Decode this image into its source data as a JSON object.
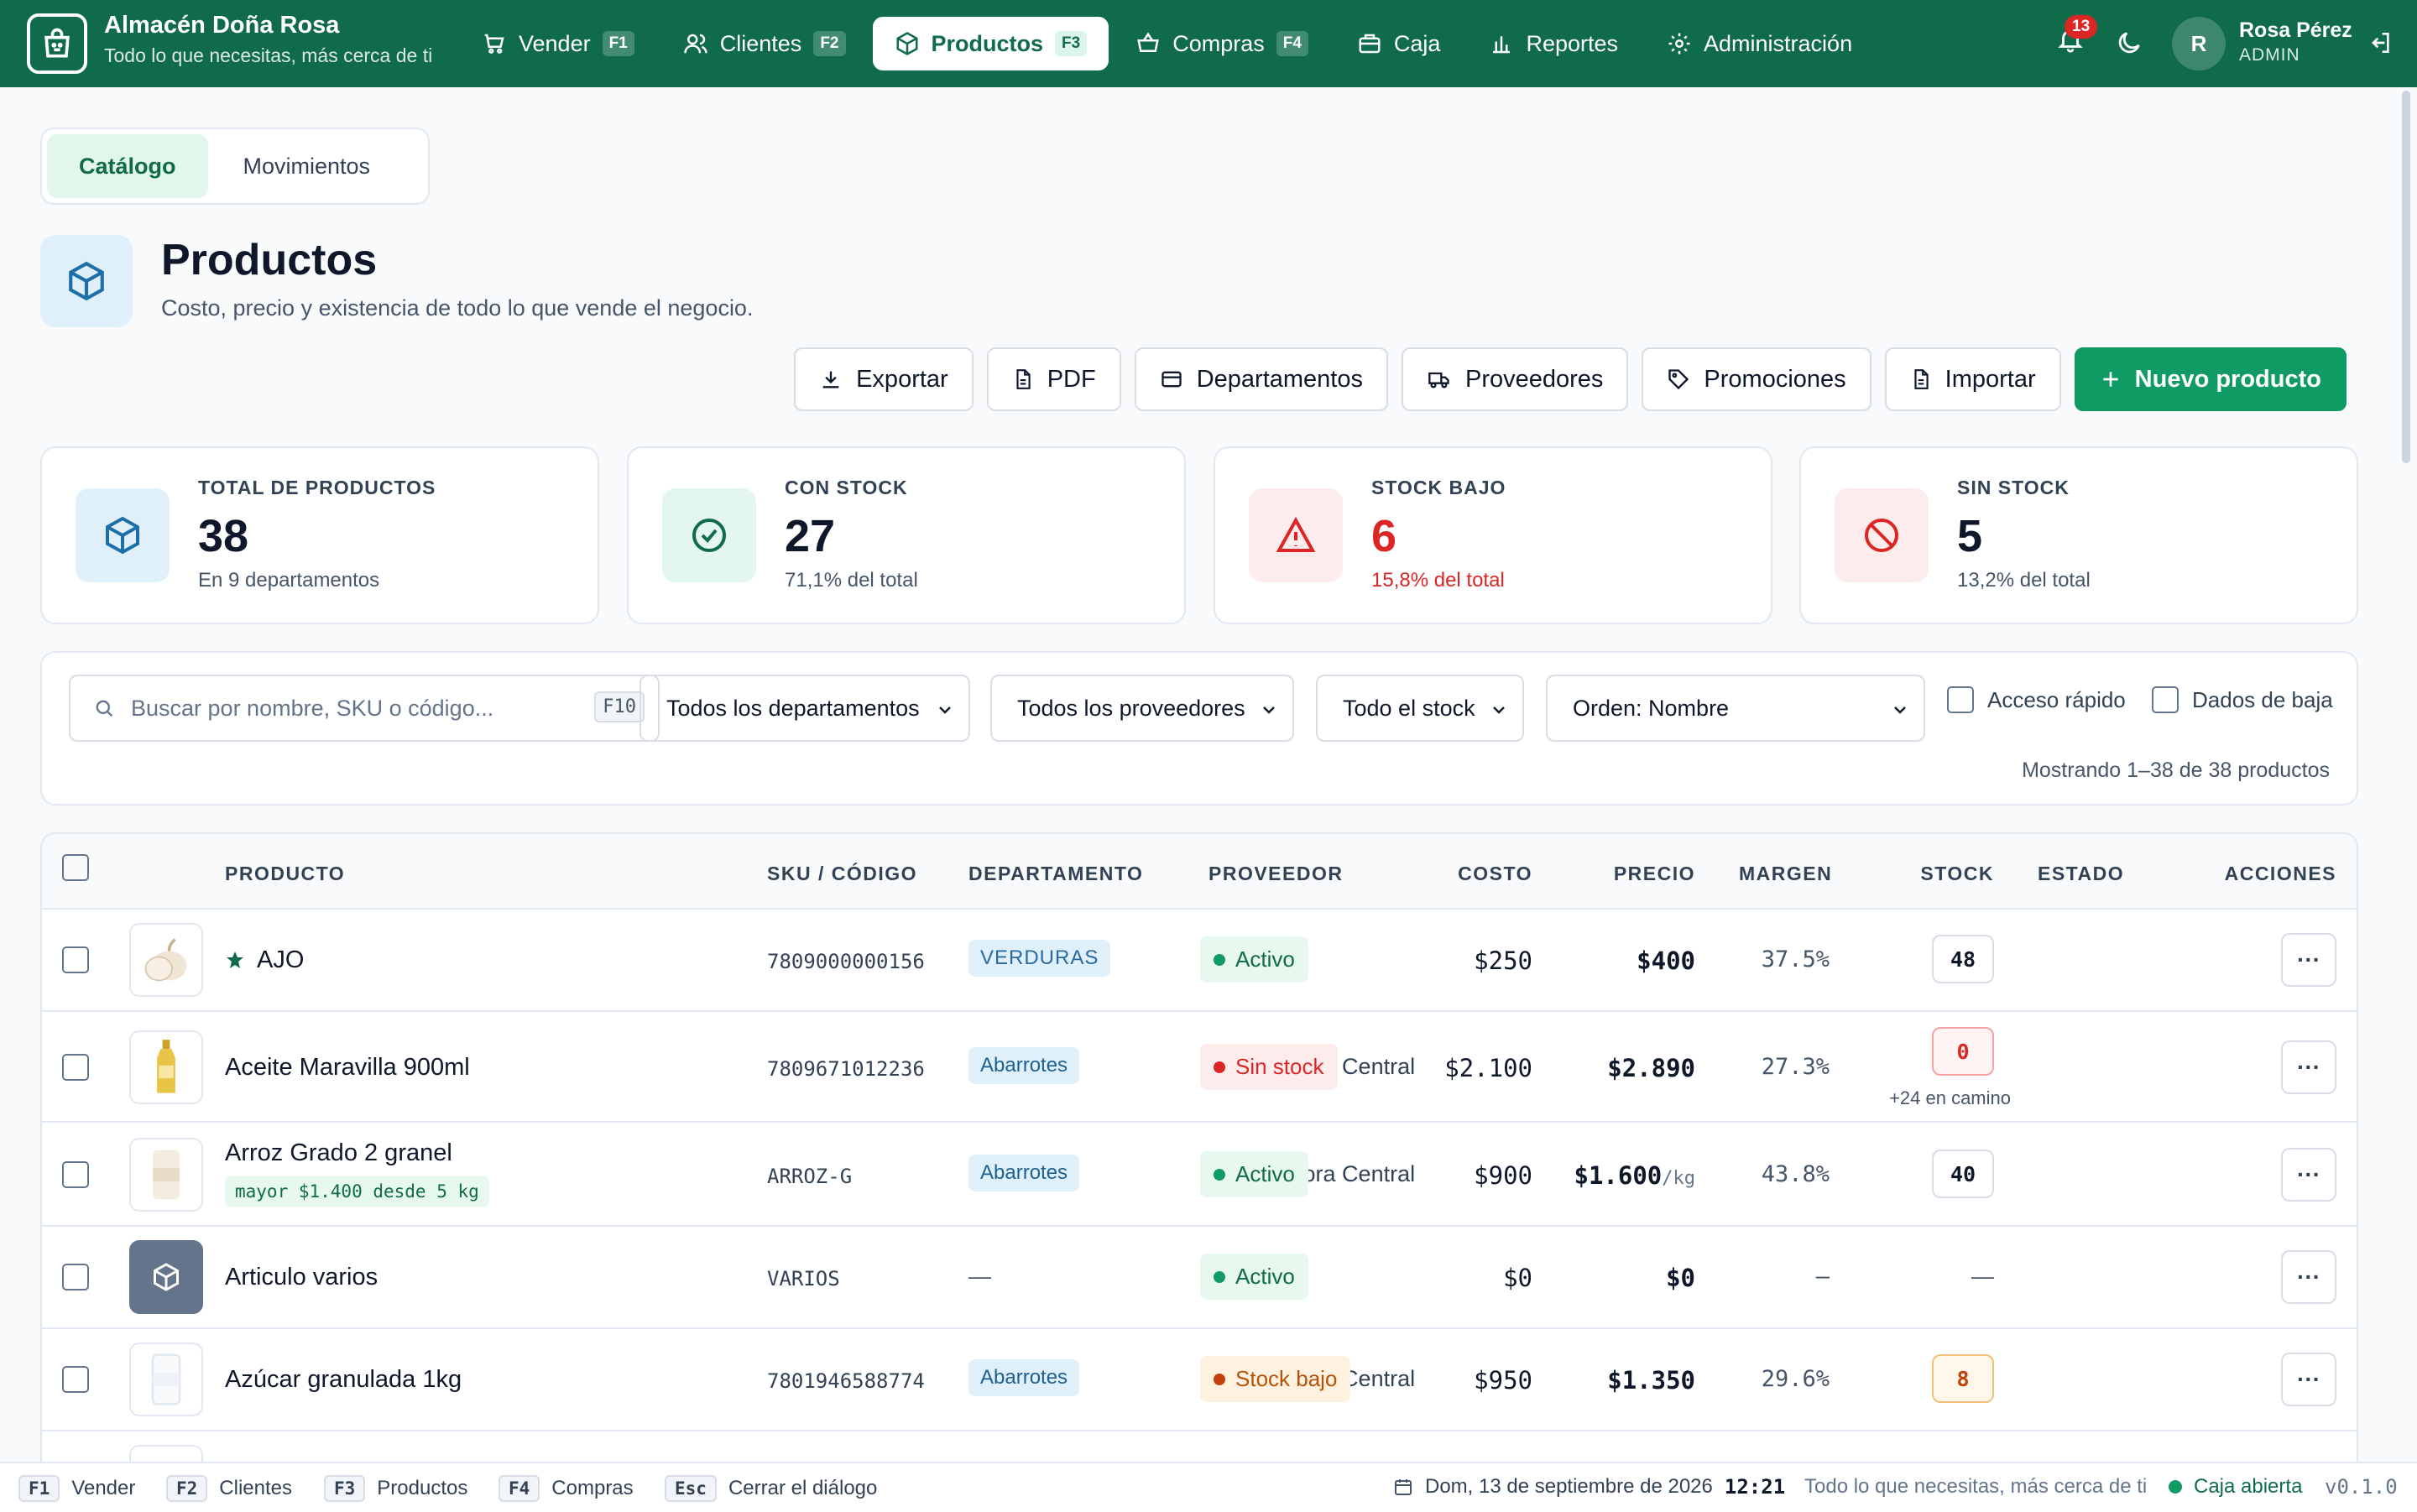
{
  "brand": {
    "name": "Almacén Doña Rosa",
    "tagline": "Todo lo que necesitas, más cerca de ti"
  },
  "nav": [
    {
      "label": "Vender",
      "key": "F1"
    },
    {
      "label": "Clientes",
      "key": "F2"
    },
    {
      "label": "Productos",
      "key": "F3",
      "active": true
    },
    {
      "label": "Compras",
      "key": "F4"
    },
    {
      "label": "Caja"
    },
    {
      "label": "Reportes"
    },
    {
      "label": "Administración"
    }
  ],
  "topbar": {
    "notifications": "13",
    "user_initial": "R",
    "user_name": "Rosa Pérez",
    "user_role": "ADMIN"
  },
  "tabs": {
    "catalog": "Catálogo",
    "movements": "Movimientos"
  },
  "header": {
    "title": "Productos",
    "subtitle": "Costo, precio y existencia de todo lo que vende el negocio."
  },
  "actions": {
    "export": "Exportar",
    "pdf": "PDF",
    "departments": "Departamentos",
    "suppliers": "Proveedores",
    "promotions": "Promociones",
    "import": "Importar",
    "new": "Nuevo producto"
  },
  "stats": [
    {
      "label": "TOTAL DE PRODUCTOS",
      "value": "38",
      "sub": "En 9 departamentos"
    },
    {
      "label": "CON STOCK",
      "value": "27",
      "sub": "71,1% del total"
    },
    {
      "label": "STOCK BAJO",
      "value": "6",
      "sub": "15,8% del total"
    },
    {
      "label": "SIN STOCK",
      "value": "5",
      "sub": "13,2% del total"
    }
  ],
  "filters": {
    "search_placeholder": "Buscar por nombre, SKU o código...",
    "search_key": "F10",
    "department": "Todos los departamentos",
    "supplier": "Todos los proveedores",
    "stock": "Todo el stock",
    "order": "Orden: Nombre",
    "quick_access": "Acceso rápido",
    "disabled": "Dados de baja",
    "showing": "Mostrando 1–38 de 38 productos"
  },
  "table": {
    "headers": {
      "product": "PRODUCTO",
      "sku": "SKU / CÓDIGO",
      "dept": "DEPARTAMENTO",
      "supplier": "PROVEEDOR",
      "cost": "COSTO",
      "price": "PRECIO",
      "margin": "MARGEN",
      "stock": "STOCK",
      "status": "ESTADO",
      "actions": "ACCIONES"
    },
    "rows": [
      {
        "name": "AJO",
        "sku": "7809000000156",
        "dept": "VERDURAS",
        "supplier": "—",
        "cost": "$250",
        "price": "$400",
        "margin": "37.5%",
        "stock": "48",
        "status": "Activo"
      },
      {
        "name": "Aceite Maravilla 900ml",
        "sku": "7809671012236",
        "dept": "Abarrotes",
        "supplier": "Distribuidora Central",
        "cost": "$2.100",
        "price": "$2.890",
        "margin": "27.3%",
        "stock": "0",
        "stock_note": "+24 en camino",
        "status": "Sin stock"
      },
      {
        "name": "Arroz Grado 2 granel",
        "tag": "mayor $1.400 desde 5 kg",
        "sku": "ARROZ-G",
        "dept": "Abarrotes",
        "supplier": "Distribuidora Central",
        "cost": "$900",
        "price": "$1.600",
        "unit": "/kg",
        "margin": "43.8%",
        "stock": "40",
        "status": "Activo"
      },
      {
        "name": "Articulo varios",
        "sku": "VARIOS",
        "dept": "—",
        "supplier": "—",
        "cost": "$0",
        "price": "$0",
        "margin": "–",
        "stock": "—",
        "status": "Activo"
      },
      {
        "name": "Azúcar granulada 1kg",
        "sku": "7801946588774",
        "dept": "Abarrotes",
        "supplier": "Distribuidora Central",
        "cost": "$950",
        "price": "$1.350",
        "margin": "29.6%",
        "stock": "8",
        "status": "Stock bajo"
      }
    ]
  },
  "footer": {
    "shortcuts": [
      {
        "key": "F1",
        "label": "Vender"
      },
      {
        "key": "F2",
        "label": "Clientes"
      },
      {
        "key": "F3",
        "label": "Productos"
      },
      {
        "key": "F4",
        "label": "Compras"
      },
      {
        "key": "Esc",
        "label": "Cerrar el diálogo"
      }
    ],
    "date": "Dom, 13 de septiembre de 2026",
    "time": "12:21",
    "tagline": "Todo lo que necesitas, más cerca de ti",
    "register": "Caja abierta",
    "version": "v0.1.0"
  },
  "colors": {
    "brand": "#0f6b4a",
    "primary": "#0f9b63",
    "danger": "#dc2626",
    "warning": "#c2410c"
  }
}
